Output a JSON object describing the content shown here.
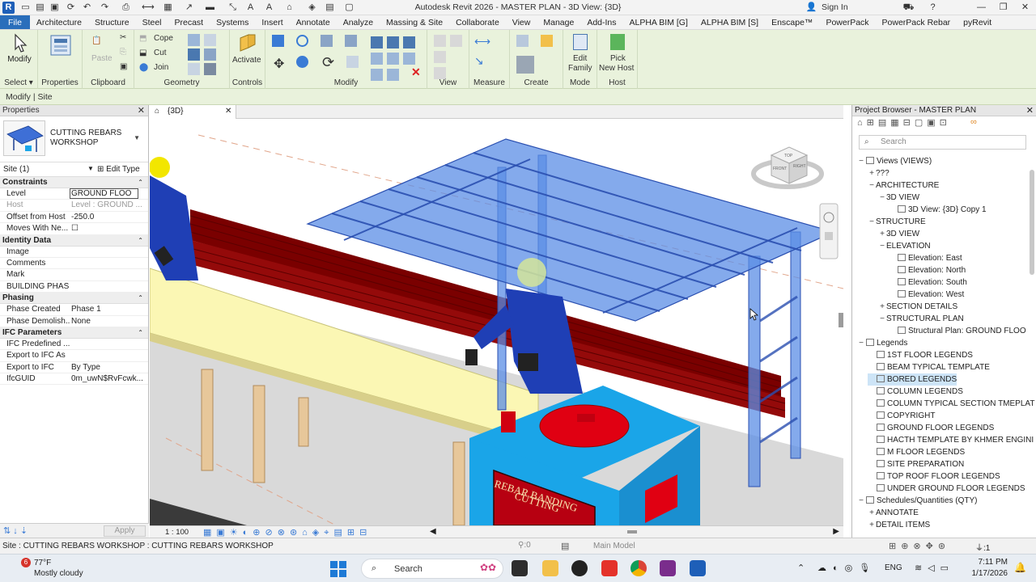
{
  "window": {
    "title": "Autodesk Revit 2026 - MASTER PLAN - 3D View: {3D}",
    "sign_in": "Sign In"
  },
  "tabs": [
    "File",
    "Architecture",
    "Structure",
    "Steel",
    "Precast",
    "Systems",
    "Insert",
    "Annotate",
    "Analyze",
    "Massing & Site",
    "Collaborate",
    "View",
    "Manage",
    "Add-Ins",
    "ALPHA BIM [G]",
    "ALPHA BIM [S]",
    "Enscape™",
    "PowerPack",
    "PowerPack Rebar",
    "pyRevit"
  ],
  "ribbon": {
    "select": {
      "modify_label": "Modify",
      "panel": "Select"
    },
    "properties": {
      "panel": "Properties"
    },
    "clipboard": {
      "paste_label": "Paste",
      "panel": "Clipboard"
    },
    "geometry": {
      "cope": "Cope",
      "cut": "Cut",
      "join": "Join",
      "panel": "Geometry"
    },
    "controls": {
      "activate": "Activate",
      "panel": "Controls"
    },
    "modify": {
      "panel": "Modify"
    },
    "view": {
      "panel": "View"
    },
    "measure": {
      "panel": "Measure"
    },
    "create": {
      "panel": "Create"
    },
    "mode": {
      "edit_family_line1": "Edit",
      "edit_family_line2": "Family",
      "panel": "Mode"
    },
    "host": {
      "pick_line1": "Pick",
      "pick_line2": "New Host",
      "panel": "Host"
    }
  },
  "context_bar": "Modify | Site",
  "properties": {
    "header": "Properties",
    "type_name": "CUTTING REBARS WORKSHOP",
    "instance_filter": "Site (1)",
    "edit_type": "Edit Type",
    "groups": [
      {
        "name": "Constraints",
        "rows": [
          {
            "k": "Level",
            "v": "GROUND FLOO",
            "edit": true
          },
          {
            "k": "Host",
            "v": "Level : GROUND ...",
            "dim": true
          },
          {
            "k": "Offset from Host",
            "v": "-250.0"
          },
          {
            "k": "Moves With Ne...",
            "v": "☐"
          }
        ]
      },
      {
        "name": "Identity Data",
        "rows": [
          {
            "k": "Image",
            "v": ""
          },
          {
            "k": "Comments",
            "v": ""
          },
          {
            "k": "Mark",
            "v": ""
          },
          {
            "k": "BUILDING PHAS...",
            "v": ""
          }
        ]
      },
      {
        "name": "Phasing",
        "rows": [
          {
            "k": "Phase Created",
            "v": "Phase 1"
          },
          {
            "k": "Phase Demolish...",
            "v": "None"
          }
        ]
      },
      {
        "name": "IFC Parameters",
        "rows": [
          {
            "k": "IFC Predefined ...",
            "v": ""
          },
          {
            "k": "Export to IFC As",
            "v": ""
          },
          {
            "k": "Export to IFC",
            "v": "By Type"
          },
          {
            "k": "IfcGUID",
            "v": "0m_uwN$RvFcwk..."
          }
        ]
      }
    ],
    "apply": "Apply"
  },
  "view": {
    "tab_label": "{3D}",
    "scale": "1 : 100",
    "sign_text_line1": "REBAR BANDING",
    "sign_text_line2": "CUTTING",
    "cube_front": "FRONT",
    "cube_right": "RIGHT",
    "cube_top": "TOP"
  },
  "browser": {
    "header": "Project Browser - MASTER PLAN",
    "search_placeholder": "Search",
    "items": [
      {
        "indent": 0,
        "exp": "−",
        "label": "Views (VIEWS)",
        "icon": true
      },
      {
        "indent": 1,
        "exp": "+",
        "label": "???"
      },
      {
        "indent": 1,
        "exp": "−",
        "label": "ARCHITECTURE"
      },
      {
        "indent": 2,
        "exp": "−",
        "label": "3D VIEW"
      },
      {
        "indent": 3,
        "exp": "",
        "label": "3D View: {3D} Copy 1",
        "icon": true
      },
      {
        "indent": 1,
        "exp": "−",
        "label": "STRUCTURE"
      },
      {
        "indent": 2,
        "exp": "+",
        "label": "3D VIEW"
      },
      {
        "indent": 2,
        "exp": "−",
        "label": "ELEVATION"
      },
      {
        "indent": 3,
        "exp": "",
        "label": "Elevation: East",
        "icon": true
      },
      {
        "indent": 3,
        "exp": "",
        "label": "Elevation: North",
        "icon": true
      },
      {
        "indent": 3,
        "exp": "",
        "label": "Elevation: South",
        "icon": true
      },
      {
        "indent": 3,
        "exp": "",
        "label": "Elevation: West",
        "icon": true
      },
      {
        "indent": 2,
        "exp": "+",
        "label": "SECTION DETAILS"
      },
      {
        "indent": 2,
        "exp": "−",
        "label": "STRUCTURAL PLAN"
      },
      {
        "indent": 3,
        "exp": "",
        "label": "Structural Plan: GROUND FLOO",
        "icon": true
      },
      {
        "indent": 0,
        "exp": "−",
        "label": "Legends",
        "icon": true
      },
      {
        "indent": 1,
        "exp": "",
        "label": "1ST FLOOR LEGENDS",
        "icon": true
      },
      {
        "indent": 1,
        "exp": "",
        "label": "BEAM TYPICAL TEMPLATE",
        "icon": true
      },
      {
        "indent": 1,
        "exp": "",
        "label": "BORED LEGENDS",
        "icon": true,
        "sel": true
      },
      {
        "indent": 1,
        "exp": "",
        "label": "COLUMN LEGENDS",
        "icon": true
      },
      {
        "indent": 1,
        "exp": "",
        "label": "COLUMN TYPICAL SECTION TMEPLAT",
        "icon": true
      },
      {
        "indent": 1,
        "exp": "",
        "label": "COPYRIGHT",
        "icon": true
      },
      {
        "indent": 1,
        "exp": "",
        "label": "GROUND FLOOR LEGENDS",
        "icon": true
      },
      {
        "indent": 1,
        "exp": "",
        "label": "HACTH TEMPLATE BY KHMER ENGINI",
        "icon": true
      },
      {
        "indent": 1,
        "exp": "",
        "label": "M FLOOR LEGENDS",
        "icon": true
      },
      {
        "indent": 1,
        "exp": "",
        "label": "SITE PREPARATION",
        "icon": true
      },
      {
        "indent": 1,
        "exp": "",
        "label": "TOP ROOF FLOOR LEGENDS",
        "icon": true
      },
      {
        "indent": 1,
        "exp": "",
        "label": "UNDER GROUND FLOOR LEGENDS",
        "icon": true
      },
      {
        "indent": 0,
        "exp": "−",
        "label": "Schedules/Quantities (QTY)",
        "icon": true
      },
      {
        "indent": 1,
        "exp": "+",
        "label": "ANNOTATE"
      },
      {
        "indent": 1,
        "exp": "+",
        "label": "DETAIL ITEMS"
      }
    ]
  },
  "status": {
    "message": "Site : CUTTING REBARS WORKSHOP : CUTTING REBARS WORKSHOP",
    "model": "Main Model",
    "filter_count": ":0",
    "select_count": ":1"
  },
  "taskbar": {
    "temperature": "77°F",
    "condition": "Mostly cloudy",
    "badge": "6",
    "search": "Search",
    "lang": "ENG",
    "time": "7:11 PM",
    "date": "1/17/2026"
  },
  "colors": {
    "ribbon_bg": "#e9f2dc",
    "file_tab": "#2a6ebb",
    "canopy_blue": "#5b8ee6",
    "rebar_red": "#8b0000",
    "machine_cyan": "#1aa5e8",
    "table_yellow": "#fbf7b4"
  }
}
